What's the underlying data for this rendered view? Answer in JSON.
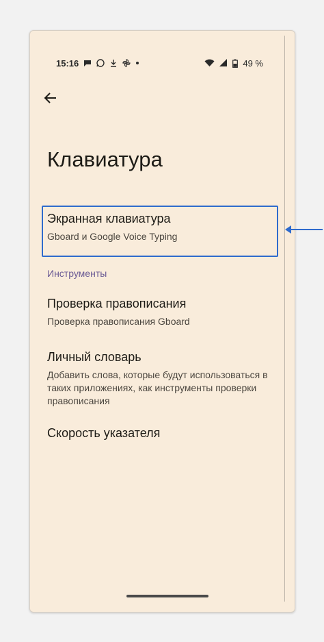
{
  "status_bar": {
    "time": "15:16",
    "battery": "49 %",
    "left_icons": [
      "chat-bubble-icon",
      "whatsapp-icon",
      "download-icon",
      "pinwheel-icon",
      "dot-icon"
    ],
    "right_icons": [
      "wifi-icon",
      "signal-icon",
      "battery-icon"
    ]
  },
  "header": {
    "back_icon": "arrow-left-icon",
    "title": "Клавиатура"
  },
  "items": [
    {
      "primary": "Экранная клавиатура",
      "secondary": "Gboard и Google Voice Typing"
    },
    {
      "section": "Инструменты"
    },
    {
      "primary": "Проверка правописания",
      "secondary": "Проверка правописания Gboard"
    },
    {
      "primary": "Личный словарь",
      "secondary": "Добавить слова, которые будут использоваться в таких приложениях, как инструменты проверки правописания"
    },
    {
      "primary": "Скорость указателя"
    }
  ],
  "annotation": {
    "highlight_color": "#2f6bcd",
    "arrow_icon": "arrow-left-pointer-icon"
  },
  "colors": {
    "background": "#f9ecdb",
    "section": "#6b5b95"
  }
}
